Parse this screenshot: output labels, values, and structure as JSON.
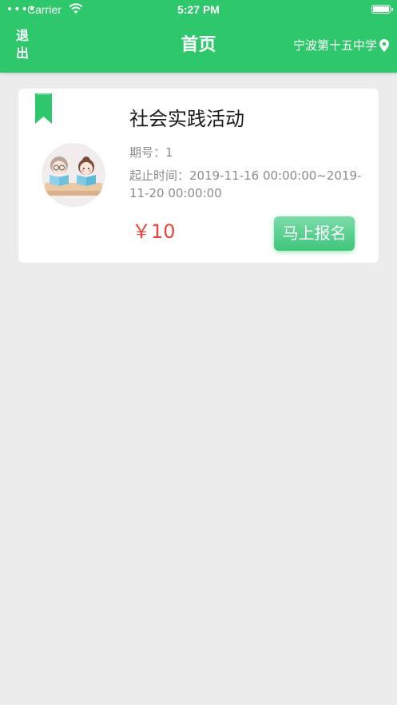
{
  "status_bar": {
    "signal": "••••",
    "carrier": "Carrier",
    "time": "5:27 PM",
    "wifi_icon": "wifi-icon",
    "battery_icon": "battery-icon"
  },
  "nav": {
    "logout": "退出",
    "title": "首页",
    "school": "宁波第十五中学",
    "location_icon": "location-pin-icon"
  },
  "activity": {
    "title": "社会实践活动",
    "issue": "期号：1",
    "time_label": "起止时间：2019-11-16 00:00:00~2019-11-20 00:00:00",
    "price": "￥10",
    "enroll_button": "马上报名",
    "bookmark_icon": "bookmark-icon",
    "avatar_icon": "reading-kids-illustration"
  },
  "colors": {
    "brand_green": "#2ec76c",
    "price_red": "#e8473a",
    "background": "#ececec"
  }
}
